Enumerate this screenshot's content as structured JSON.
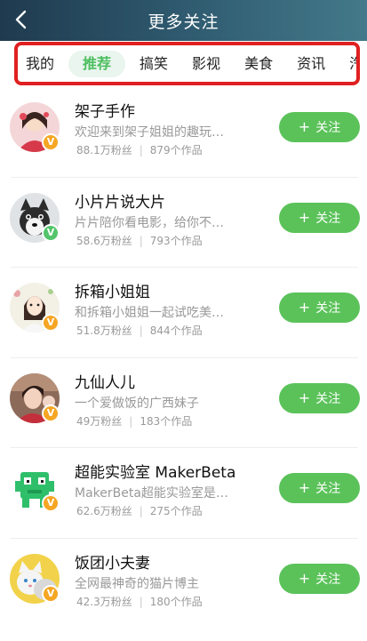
{
  "header": {
    "title": "更多关注"
  },
  "tabs": [
    {
      "label": "我的"
    },
    {
      "label": "推荐"
    },
    {
      "label": "搞笑"
    },
    {
      "label": "影视"
    },
    {
      "label": "美食"
    },
    {
      "label": "资讯"
    },
    {
      "label": "汽"
    }
  ],
  "follow_label": "关注",
  "follow_plus": "+",
  "verified_mark": "V",
  "accent_color": "#5bc25a",
  "items": [
    {
      "name": "架子手作",
      "desc": "欢迎来到架子姐姐的趣玩…",
      "fans": "88.1万粉丝",
      "works": "879个作品",
      "badge": "orange"
    },
    {
      "name": "小片片说大片",
      "desc": "片片陪你看电影，给你不…",
      "fans": "58.6万粉丝",
      "works": "793个作品",
      "badge": "green"
    },
    {
      "name": "拆箱小姐姐",
      "desc": "和拆箱小姐姐一起试吃美…",
      "fans": "51.8万粉丝",
      "works": "844个作品",
      "badge": "orange"
    },
    {
      "name": "九仙人儿",
      "desc": "一个爱做饭的广西妹子",
      "fans": "49万粉丝",
      "works": "183个作品",
      "badge": "orange"
    },
    {
      "name": "超能实验室 MakerBeta",
      "desc": "MakerBeta超能实验室是…",
      "fans": "62.6万粉丝",
      "works": "275个作品",
      "badge": "orange"
    },
    {
      "name": "饭团小夫妻",
      "desc": "全网最神奇的猫片博主",
      "fans": "42.3万粉丝",
      "works": "180个作品",
      "badge": "orange"
    }
  ]
}
